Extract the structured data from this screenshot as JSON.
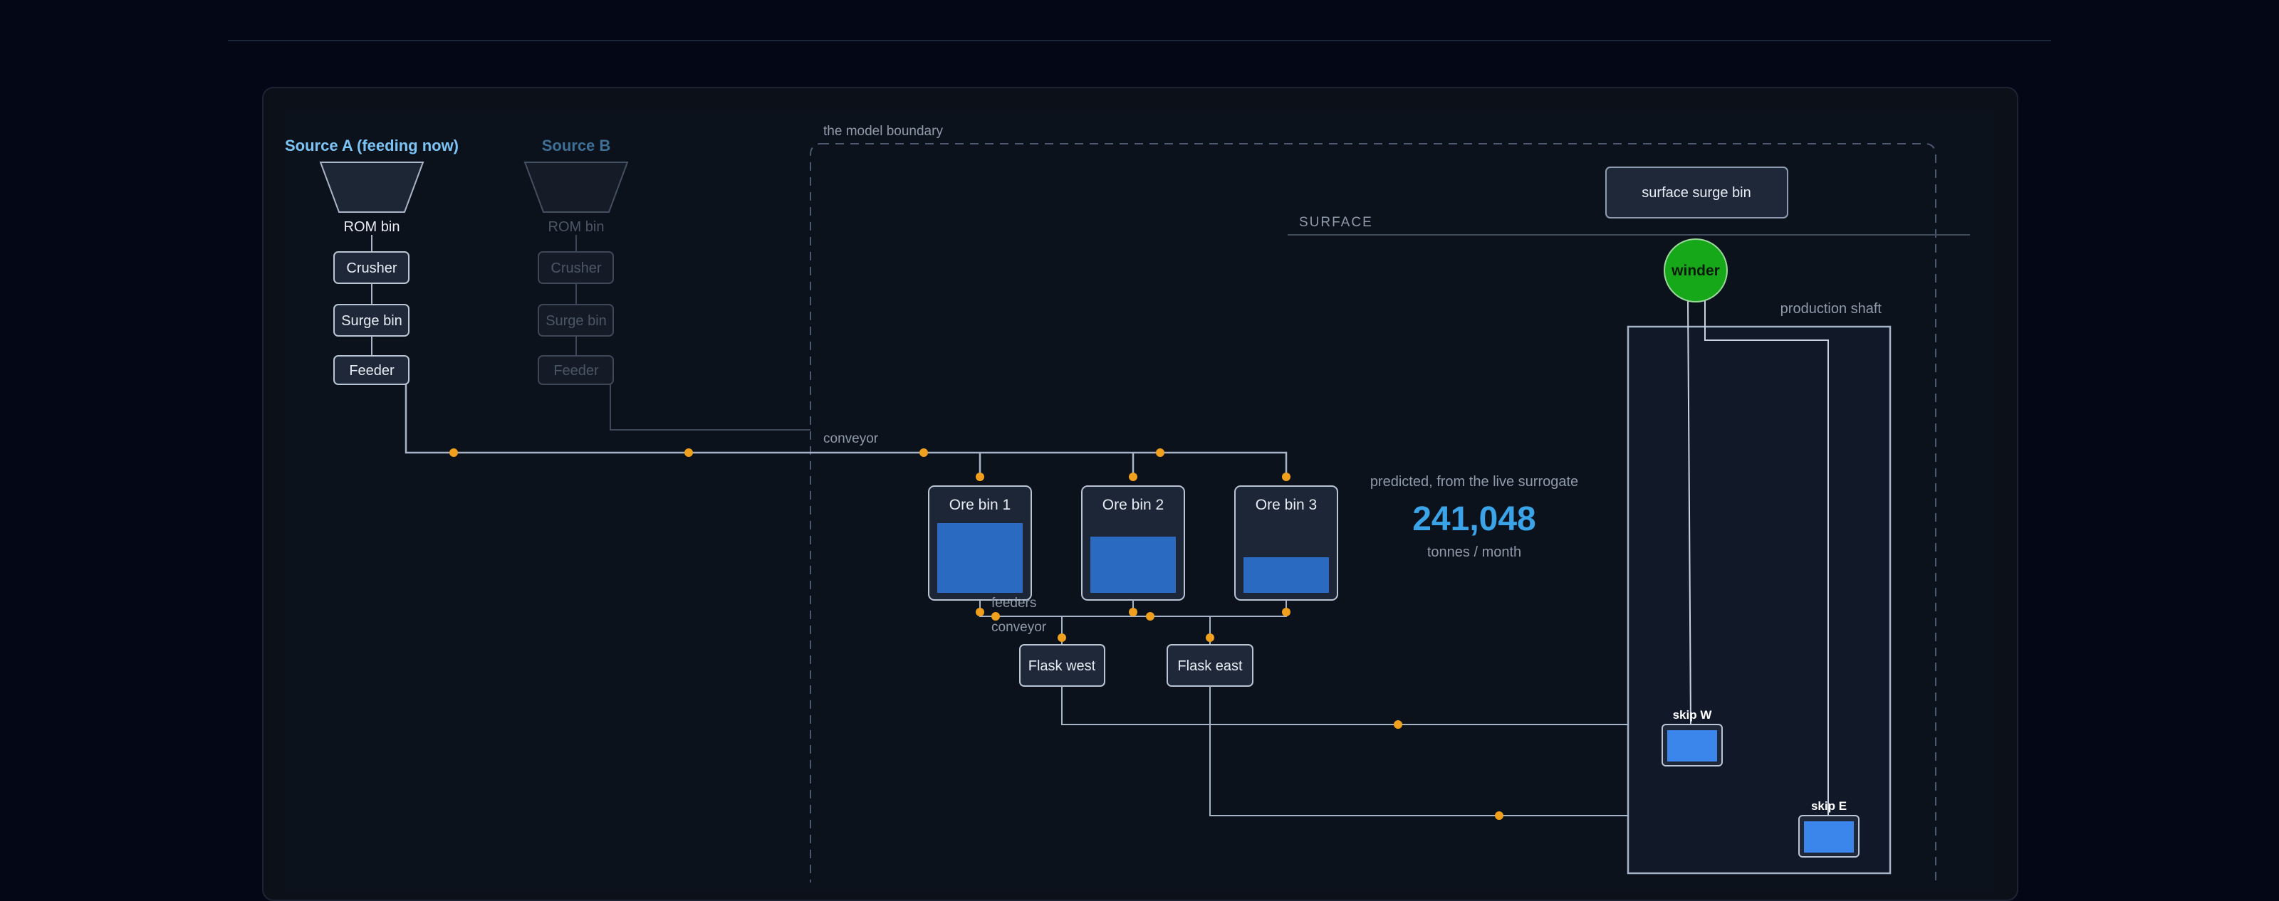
{
  "source_a": {
    "title": "Source A (feeding now)",
    "rom_bin": "ROM bin",
    "crusher": "Crusher",
    "surge_bin": "Surge bin",
    "feeder": "Feeder"
  },
  "source_b": {
    "title": "Source B",
    "rom_bin": "ROM bin",
    "crusher": "Crusher",
    "surge_bin": "Surge bin",
    "feeder": "Feeder"
  },
  "boundary_label": "the model boundary",
  "conveyor_label": "conveyor",
  "ore_bins": [
    {
      "label": "Ore bin 1",
      "fill_fraction": 0.72
    },
    {
      "label": "Ore bin 2",
      "fill_fraction": 0.58
    },
    {
      "label": "Ore bin 3",
      "fill_fraction": 0.37
    }
  ],
  "feeders_label": "feeders",
  "conveyor2_label": "conveyor",
  "flasks": {
    "west": "Flask west",
    "east": "Flask east"
  },
  "prediction": {
    "caption": "predicted, from the live surrogate",
    "value": "241,048",
    "unit": "tonnes / month"
  },
  "surface": {
    "surge_bin": "surface surge bin",
    "surface_label": "SURFACE",
    "winder": "winder",
    "shaft_label": "production shaft",
    "skip_w": "skip W",
    "skip_e": "skip E"
  },
  "colors": {
    "line": "#a7b3c7",
    "dot": "#f0a01c",
    "ore_fill": "#2a6ac0",
    "skip_fill": "#3a86ea",
    "winder": "#17a81a",
    "accent_text": "#3ba3e8",
    "source_a": "#7cc4f5",
    "source_b": "#3e6f96"
  }
}
